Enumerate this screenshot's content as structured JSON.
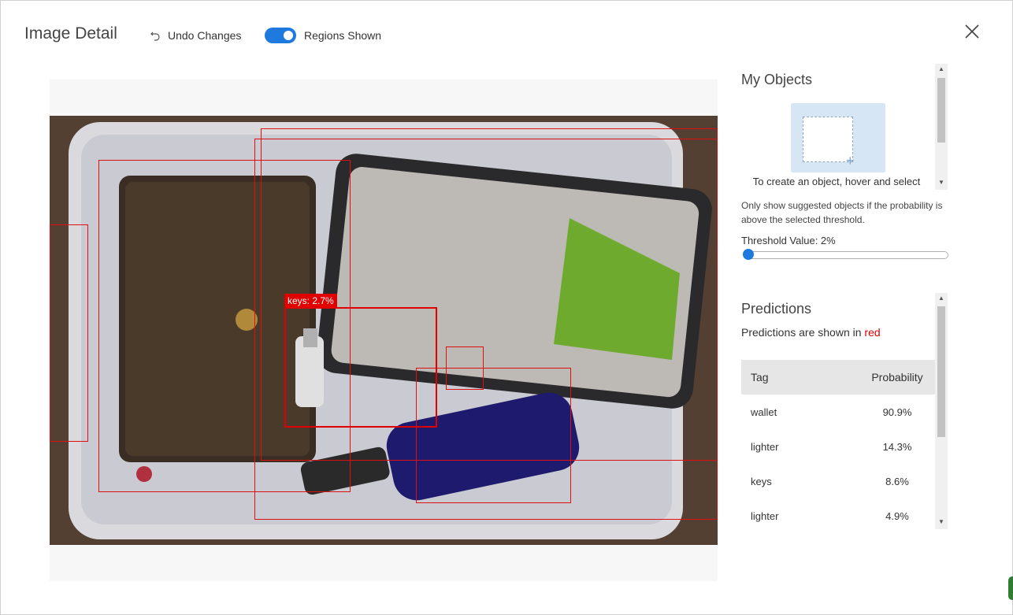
{
  "header": {
    "title": "Image Detail",
    "undo_label": "Undo Changes",
    "regions_toggle_label": "Regions Shown",
    "regions_toggle_on": true
  },
  "image": {
    "selected_region_label": "keys: 2.7%"
  },
  "my_objects": {
    "title": "My Objects",
    "hint": "To create an object, hover and select",
    "note": "Only show suggested objects if the probability is above the selected threshold.",
    "threshold_label": "Threshold Value: 2%",
    "threshold_value": 0.02
  },
  "predictions": {
    "title": "Predictions",
    "subtitle_prefix": "Predictions are shown in ",
    "subtitle_color_word": "red",
    "columns": {
      "tag": "Tag",
      "probability": "Probability"
    },
    "rows": [
      {
        "tag": "wallet",
        "probability": "90.9%"
      },
      {
        "tag": "lighter",
        "probability": "14.3%"
      },
      {
        "tag": "keys",
        "probability": "8.6%"
      },
      {
        "tag": "lighter",
        "probability": "4.9%"
      }
    ]
  },
  "colors": {
    "accent": "#1f7ae0",
    "region": "#e01010",
    "hint_card": "#d6e6f4"
  }
}
